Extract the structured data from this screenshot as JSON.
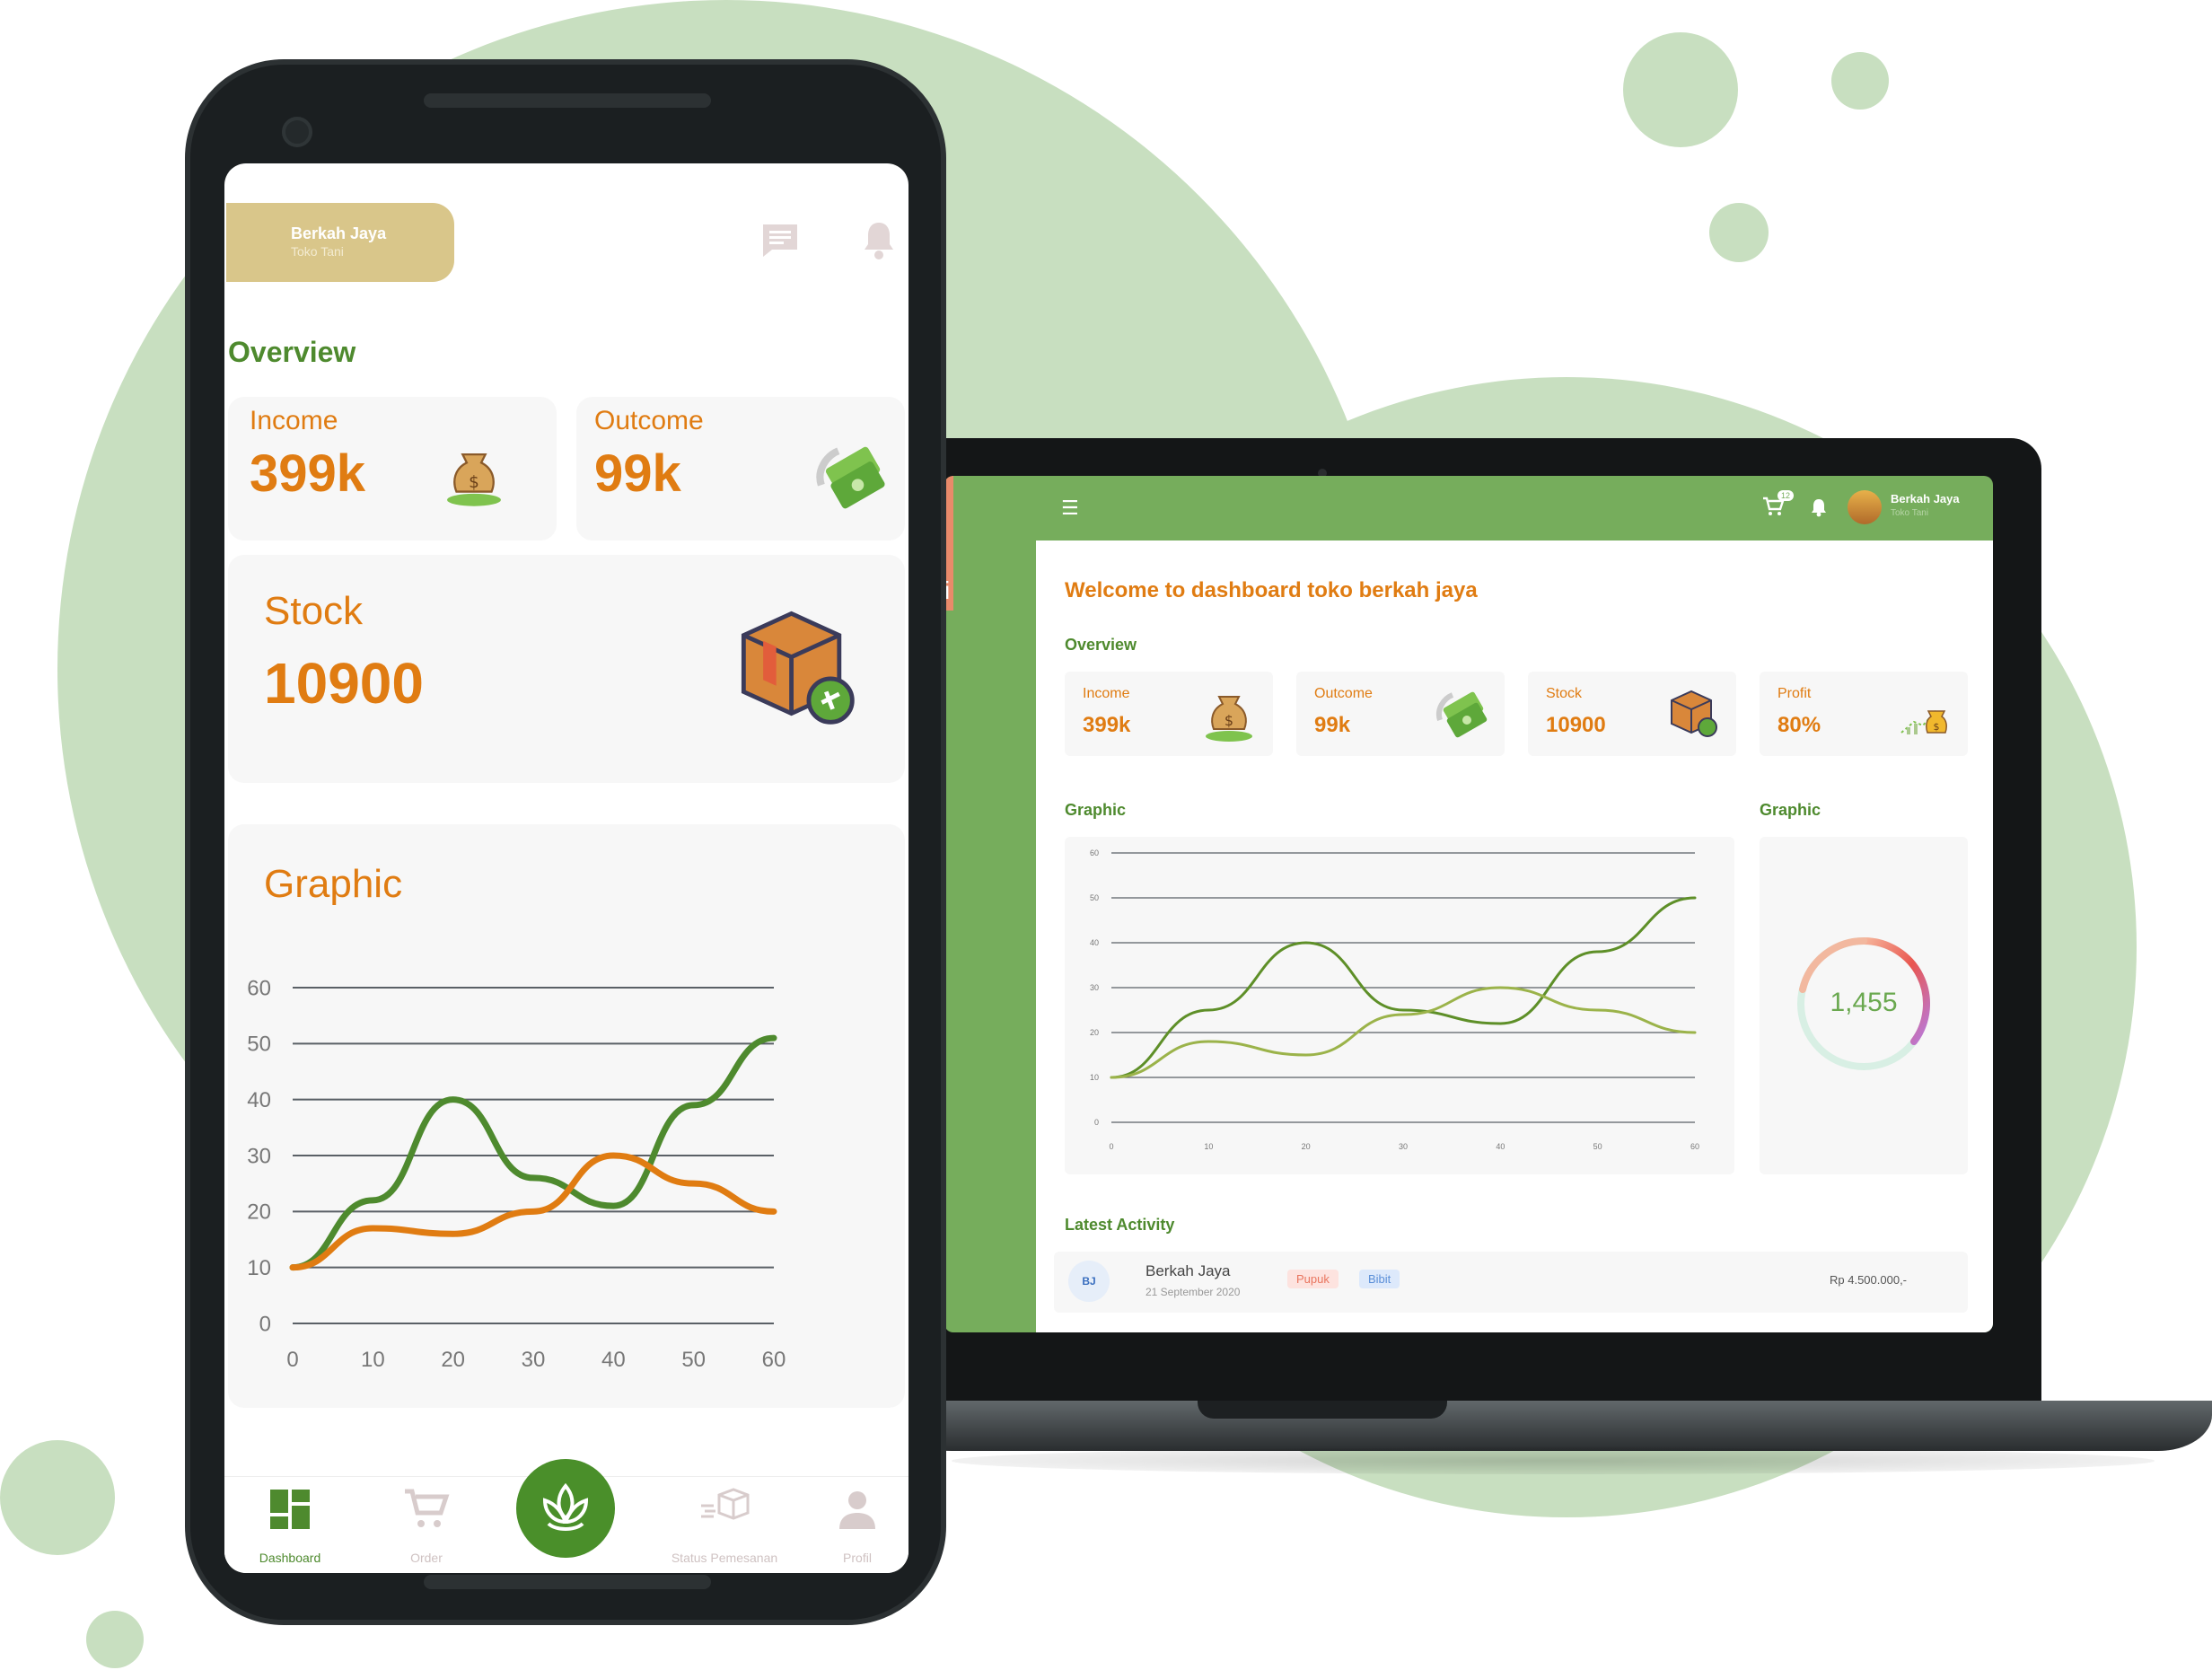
{
  "colors": {
    "brand_green": "#4e8a2e",
    "accent_orange": "#e07c12",
    "topbar_green": "#76ad5c",
    "card_gray": "#f7f7f7",
    "store_gold": "#d9c68a",
    "background_green": "#c8dfc0"
  },
  "phone": {
    "store": {
      "name": "Berkah Jaya",
      "subtitle": "Toko Tani"
    },
    "header_icons": [
      "chat-icon",
      "bell-icon"
    ],
    "overview_title": "Overview",
    "income": {
      "label": "Income",
      "value": "399k",
      "icon": "money-bag-icon"
    },
    "outcome": {
      "label": "Outcome",
      "value": "99k",
      "icon": "flying-money-icon"
    },
    "stock": {
      "label": "Stock",
      "value": "10900",
      "icon": "box-shipping-icon"
    },
    "graphic_title": "Graphic",
    "nav": [
      {
        "label": "Dashboard",
        "icon": "dashboard-icon",
        "active": true
      },
      {
        "label": "Order",
        "icon": "cart-icon",
        "active": false
      },
      {
        "label": "",
        "icon": "lotus-logo-icon",
        "active": false
      },
      {
        "label": "Status Pemesanan",
        "icon": "delivery-box-icon",
        "active": false
      },
      {
        "label": "Profil",
        "icon": "user-icon",
        "active": false
      }
    ]
  },
  "laptop": {
    "side_letter": "i",
    "topbar": {
      "menu_icon": "hamburger-icon",
      "cart_badge": "12",
      "user_name": "Berkah Jaya",
      "user_subtitle": "Toko Tani"
    },
    "welcome": "Welcome to dashboard toko berkah jaya",
    "overview_title": "Overview",
    "stats": [
      {
        "label": "Income",
        "value": "399k",
        "icon": "money-bag-icon"
      },
      {
        "label": "Outcome",
        "value": "99k",
        "icon": "flying-money-icon"
      },
      {
        "label": "Stock",
        "value": "10900",
        "icon": "box-shipping-icon"
      },
      {
        "label": "Profit",
        "value": "80%",
        "icon": "profit-chart-icon"
      }
    ],
    "graphic_title": "Graphic",
    "graphic_title_2": "Graphic",
    "donut_value": "1,455",
    "latest_activity_title": "Latest Activity",
    "activity": {
      "initials": "BJ",
      "name": "Berkah Jaya",
      "date": "21 September 2020",
      "tags": [
        "Pupuk",
        "Bibit"
      ],
      "amount": "Rp 4.500.000,-"
    }
  },
  "chart_data": [
    {
      "type": "line",
      "title": "Graphic",
      "x": [
        0,
        10,
        20,
        30,
        40,
        50,
        60
      ],
      "xticks": [
        0,
        10,
        20,
        30,
        40,
        50,
        60
      ],
      "yticks": [
        0,
        10,
        20,
        30,
        40,
        50,
        60
      ],
      "xlim": [
        0,
        60
      ],
      "ylim": [
        0,
        60
      ],
      "grid": true,
      "series": [
        {
          "color": "#4e8a2e",
          "values": [
            10,
            22,
            40,
            26,
            21,
            39,
            51
          ]
        },
        {
          "color": "#e07c12",
          "values": [
            10,
            17,
            16,
            20,
            30,
            25,
            20
          ]
        }
      ]
    },
    {
      "type": "line",
      "title": "Graphic",
      "x": [
        0,
        10,
        20,
        30,
        40,
        50,
        60
      ],
      "xticks": [
        0,
        10,
        20,
        30,
        40,
        50,
        60
      ],
      "yticks": [
        0,
        10,
        20,
        30,
        40,
        50,
        60
      ],
      "xlim": [
        0,
        60
      ],
      "ylim": [
        0,
        60
      ],
      "grid": true,
      "series": [
        {
          "color": "#5e8f28",
          "values": [
            10,
            25,
            40,
            25,
            22,
            38,
            50
          ]
        },
        {
          "color": "#9bb34a",
          "values": [
            10,
            18,
            15,
            24,
            30,
            25,
            20
          ]
        }
      ]
    }
  ]
}
